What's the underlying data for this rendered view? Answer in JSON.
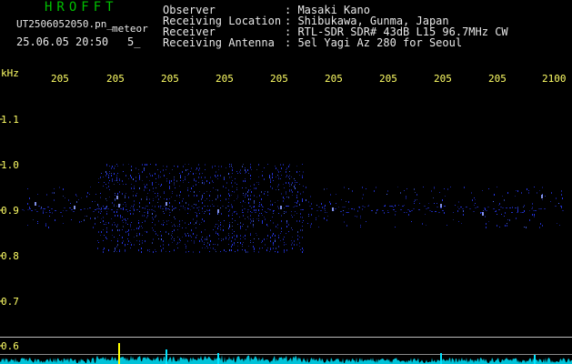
{
  "app": {
    "title": "HROFFT",
    "file_name": "UT2506052050.pn_",
    "meteor_label": "meteor",
    "date_time": "25.06.05 20:50",
    "count": "5_"
  },
  "info": [
    {
      "key": "Observer",
      "value": ": Masaki Kano"
    },
    {
      "key": "Receiving Location",
      "value": ": Shibukawa, Gunma, Japan"
    },
    {
      "key": "Receiver",
      "value": ": RTL-SDR SDR# 43dB L15 96.7MHz CW"
    },
    {
      "key": "Receiving Antenna",
      "value": ": 5el Yagi Az 280 for Seoul"
    }
  ],
  "axes": {
    "unit": "kHz",
    "x_ticks": [
      "205",
      "205",
      "205",
      "205",
      "205",
      "205",
      "205",
      "205",
      "205",
      "2100"
    ],
    "y_ticks": [
      "1.1",
      "1.0",
      "0.9",
      "0.8",
      "0.7",
      "0.6"
    ]
  },
  "colors": {
    "background": "#000000",
    "title": "#00c000",
    "labels": "#ffff66",
    "signal": "#2a3cff",
    "spectrum": "#00e5ff",
    "marker": "#ffff00"
  }
}
